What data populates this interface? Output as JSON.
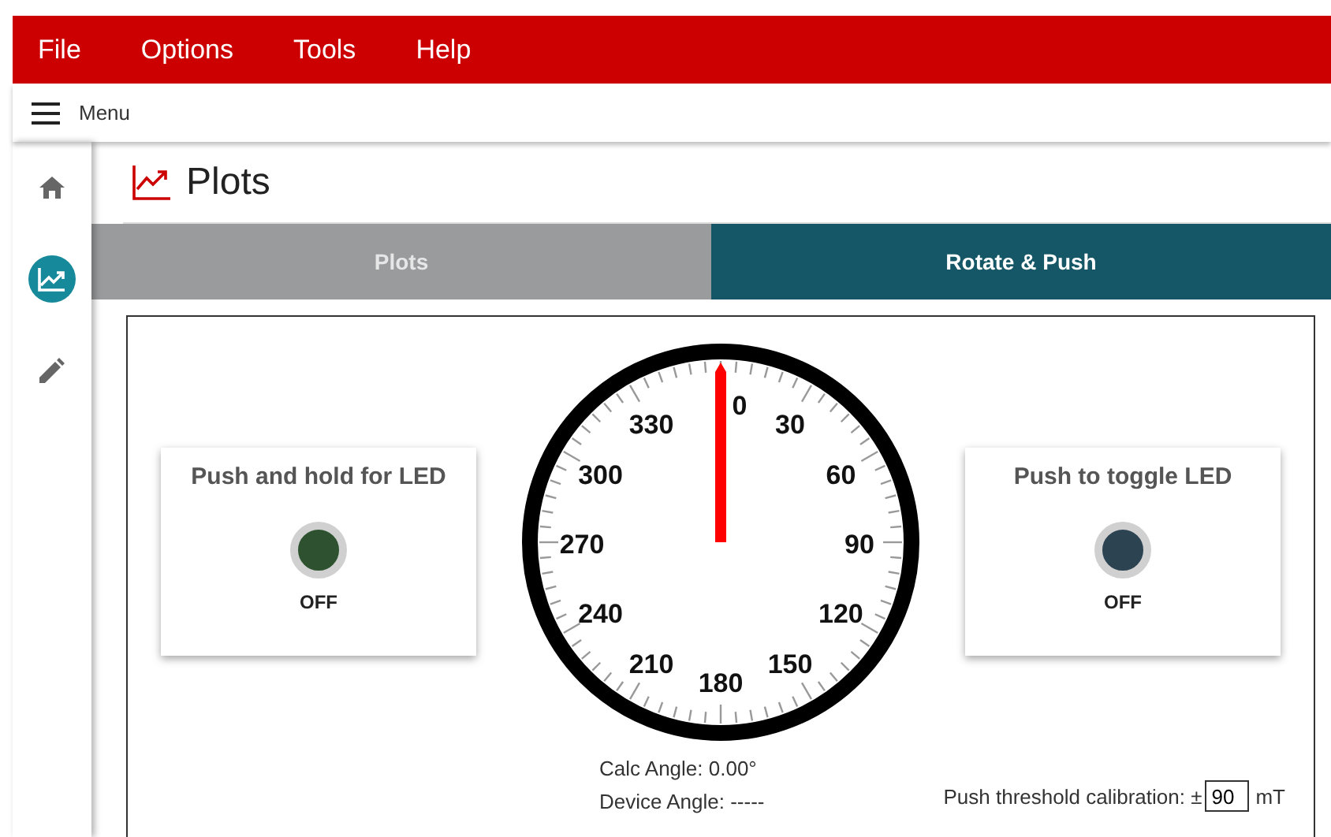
{
  "menu_bar": {
    "items": [
      "File",
      "Options",
      "Tools",
      "Help"
    ]
  },
  "toolbar": {
    "menu_label": "Menu"
  },
  "sidebar": {
    "items": [
      {
        "kind": "home",
        "selected": false
      },
      {
        "kind": "chart",
        "selected": true
      },
      {
        "kind": "pencil",
        "selected": false
      }
    ]
  },
  "page": {
    "title": "Plots"
  },
  "tabs": [
    {
      "label": "Plots",
      "selected": false
    },
    {
      "label": "Rotate & Push",
      "selected": true
    }
  ],
  "led_cards": [
    {
      "title": "Push and hold for LED",
      "on": false,
      "state": "OFF",
      "color": "#2e5230"
    },
    {
      "title": "Push to toggle LED",
      "on": false,
      "state": "OFF",
      "color": "#2c4352"
    }
  ],
  "gauge": {
    "labels": [
      "0",
      "30",
      "60",
      "90",
      "120",
      "150",
      "180",
      "210",
      "240",
      "270",
      "300",
      "330"
    ]
  },
  "readouts": [
    "Calc Angle: 0.00°",
    "Device Angle: -----"
  ],
  "threshold": {
    "label": "Push threshold calibration: ±",
    "value": "90",
    "unit": "mT"
  }
}
